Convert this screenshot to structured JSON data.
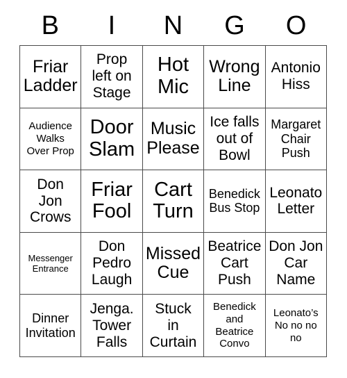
{
  "header": {
    "letters": [
      "B",
      "I",
      "N",
      "G",
      "O"
    ]
  },
  "grid": {
    "rows": [
      [
        {
          "text": "Friar\nLadder",
          "size": "fs-lg"
        },
        {
          "text": "Prop\nleft on\nStage",
          "size": "fs-md"
        },
        {
          "text": "Hot\nMic",
          "size": "fs-xl"
        },
        {
          "text": "Wrong\nLine",
          "size": "fs-lg"
        },
        {
          "text": "Antonio\nHiss",
          "size": "fs-md"
        }
      ],
      [
        {
          "text": "Audience\nWalks\nOver Prop",
          "size": "fs-xs"
        },
        {
          "text": "Door\nSlam",
          "size": "fs-xl"
        },
        {
          "text": "Music\nPlease",
          "size": "fs-lg"
        },
        {
          "text": "Ice falls\nout of\nBowl",
          "size": "fs-md"
        },
        {
          "text": "Margaret\nChair\nPush",
          "size": "fs-sm"
        }
      ],
      [
        {
          "text": "Don\nJon\nCrows",
          "size": "fs-md"
        },
        {
          "text": "Friar\nFool",
          "size": "fs-xl"
        },
        {
          "text": "Cart\nTurn",
          "size": "fs-xl"
        },
        {
          "text": "Benedick\nBus Stop",
          "size": "fs-sm"
        },
        {
          "text": "Leonato\nLetter",
          "size": "fs-md"
        }
      ],
      [
        {
          "text": "Messenger\nEntrance",
          "size": "fs-xxs"
        },
        {
          "text": "Don\nPedro\nLaugh",
          "size": "fs-md"
        },
        {
          "text": "Missed\nCue",
          "size": "fs-lg"
        },
        {
          "text": "Beatrice\nCart\nPush",
          "size": "fs-md"
        },
        {
          "text": "Don Jon\nCar\nName",
          "size": "fs-md"
        }
      ],
      [
        {
          "text": "Dinner\nInvitation",
          "size": "fs-sm"
        },
        {
          "text": "Jenga.\nTower\nFalls",
          "size": "fs-md"
        },
        {
          "text": "Stuck\nin\nCurtain",
          "size": "fs-md"
        },
        {
          "text": "Benedick\nand\nBeatrice\nConvo",
          "size": "fs-xs"
        },
        {
          "text": "Leonato’s\nNo no no\nno",
          "size": "fs-xs"
        }
      ]
    ]
  },
  "colors": {
    "background": "#ffffff",
    "text": "#000000",
    "border": "#4a4a4a"
  }
}
